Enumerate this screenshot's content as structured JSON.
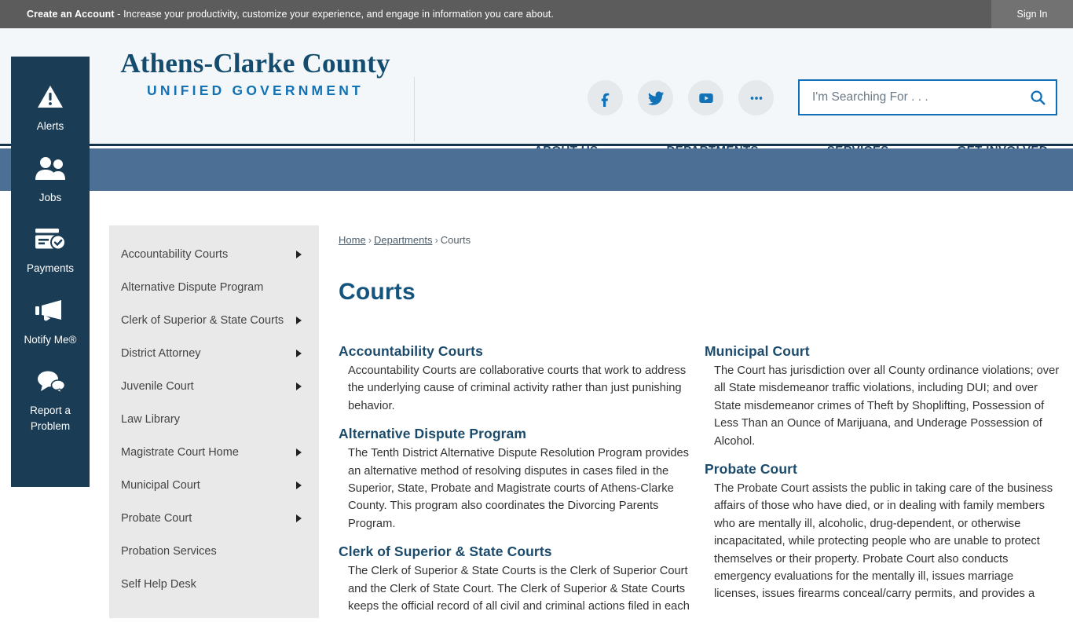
{
  "topbar": {
    "cta_bold": "Create an Account",
    "cta_rest": " - Increase your productivity, customize your experience, and engage in information you care about.",
    "signin_label": "Sign In"
  },
  "header": {
    "logo_title": "Athens-Clarke County",
    "logo_subtitle": "UNIFIED GOVERNMENT",
    "social": [
      {
        "name": "facebook-icon",
        "label": "Facebook"
      },
      {
        "name": "twitter-icon",
        "label": "Twitter"
      },
      {
        "name": "youtube-icon",
        "label": "YouTube"
      },
      {
        "name": "more-icon",
        "label": "More"
      }
    ],
    "search": {
      "placeholder": "I'm Searching For . . .",
      "value": "",
      "button_icon": "search-icon"
    },
    "nav": [
      {
        "label": "ABOUT US"
      },
      {
        "label": "DEPARTMENTS"
      },
      {
        "label": "SERVICES"
      },
      {
        "label": "GET INVOLVED"
      }
    ]
  },
  "rail": {
    "items": [
      {
        "icon": "alert-triangle-icon",
        "label": "Alerts"
      },
      {
        "icon": "people-icon",
        "label": "Jobs"
      },
      {
        "icon": "payment-card-icon",
        "label": "Payments"
      },
      {
        "icon": "megaphone-icon",
        "label": "Notify Me®"
      },
      {
        "icon": "speech-bubbles-icon",
        "label": "Report a\nProblem"
      }
    ]
  },
  "sidenav": {
    "items": [
      {
        "label": "Accountability Courts",
        "has_arrow": true
      },
      {
        "label": "Alternative Dispute Program",
        "has_arrow": false
      },
      {
        "label": "Clerk of Superior & State Courts",
        "has_arrow": true
      },
      {
        "label": "District Attorney",
        "has_arrow": true
      },
      {
        "label": "Juvenile Court",
        "has_arrow": true
      },
      {
        "label": "Law Library",
        "has_arrow": false
      },
      {
        "label": "Magistrate Court Home",
        "has_arrow": true
      },
      {
        "label": "Municipal Court",
        "has_arrow": true
      },
      {
        "label": "Probate Court",
        "has_arrow": true
      },
      {
        "label": "Probation Services",
        "has_arrow": false
      },
      {
        "label": "Self Help Desk",
        "has_arrow": false
      }
    ]
  },
  "breadcrumb": {
    "home": "Home",
    "departments": "Departments",
    "current": "Courts",
    "separator": "›"
  },
  "page": {
    "title": "Courts",
    "left_sections": [
      {
        "heading": "Accountability Courts",
        "body": "Accountability Courts are collaborative courts that work to address the underlying cause of criminal activity rather than just punishing behavior."
      },
      {
        "heading": "Alternative Dispute Program",
        "body": "The Tenth District Alternative Dispute Resolution Program provides an alternative method of resolving disputes in cases filed in the Superior, State, Probate and Magistrate courts of Athens-Clarke County. This program also coordinates the Divorcing Parents Program."
      },
      {
        "heading": "Clerk of Superior & State Courts",
        "body": "The Clerk of Superior & State Courts is the Clerk of Superior Court and the Clerk of State Court. The Clerk of Superior & State Courts keeps the official record of all civil and criminal actions filed in each"
      }
    ],
    "right_sections": [
      {
        "heading": "Municipal Court",
        "body": "The Court has jurisdiction over all County ordinance violations; over all State misdemeanor traffic violations, including DUI; and over State misdemeanor crimes of Theft by Shoplifting, Possession of Less Than an Ounce of Marijuana, and Underage Possession of Alcohol."
      },
      {
        "heading": "Probate Court",
        "body": "The Probate Court assists the public in taking care of the business affairs of those who have died, or in dealing with family members who are mentally ill, alcoholic, drug-dependent, or otherwise incapacitated, while protecting people who are unable to protect themselves or their property. Probate Court also conducts emergency evaluations for the mentally ill, issues marriage licenses, issues firearms conceal/carry permits, and provides a"
      }
    ]
  },
  "colors": {
    "brand_navy": "#15547c",
    "brand_blue": "#1272b5",
    "rail_navy": "#1a3c55",
    "band_blue": "#4c7095",
    "topbar_gray": "#5c5c5c",
    "sidenav_gray": "#e9e9e9"
  }
}
